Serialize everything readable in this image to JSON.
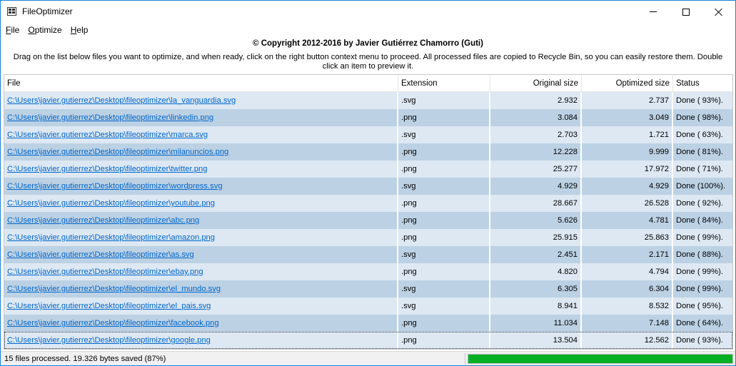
{
  "window": {
    "title": "FileOptimizer",
    "icon": "app-grid-icon"
  },
  "menu": [
    {
      "mnemonic": "F",
      "rest": "ile"
    },
    {
      "mnemonic": "O",
      "rest": "ptimize"
    },
    {
      "mnemonic": "H",
      "rest": "elp"
    }
  ],
  "header": {
    "copyright": "© Copyright 2012-2016 by Javier Gutiérrez Chamorro (Guti)",
    "instructions": "Drag on the list below files you want to optimize, and when ready, click on the right button context menu to proceed. All processed files are copied to Recycle Bin, so you can easily restore them. Double click an item to preview it."
  },
  "columns": {
    "file": "File",
    "extension": "Extension",
    "original_size": "Original size",
    "optimized_size": "Optimized size",
    "status": "Status"
  },
  "rows": [
    {
      "file": "C:\\Users\\javier.gutierrez\\Desktop\\fileoptimizer\\la_vanguardia.svg",
      "ext": ".svg",
      "orig": "2.932",
      "opt": "2.737",
      "status": "Done ( 93%)."
    },
    {
      "file": "C:\\Users\\javier.gutierrez\\Desktop\\fileoptimizer\\linkedin.png",
      "ext": ".png",
      "orig": "3.084",
      "opt": "3.049",
      "status": "Done ( 98%)."
    },
    {
      "file": "C:\\Users\\javier.gutierrez\\Desktop\\fileoptimizer\\marca.svg",
      "ext": ".svg",
      "orig": "2.703",
      "opt": "1.721",
      "status": "Done ( 63%)."
    },
    {
      "file": "C:\\Users\\javier.gutierrez\\Desktop\\fileoptimizer\\milanuncios.png",
      "ext": ".png",
      "orig": "12.228",
      "opt": "9.999",
      "status": "Done ( 81%)."
    },
    {
      "file": "C:\\Users\\javier.gutierrez\\Desktop\\fileoptimizer\\twitter.png",
      "ext": ".png",
      "orig": "25.277",
      "opt": "17.972",
      "status": "Done ( 71%)."
    },
    {
      "file": "C:\\Users\\javier.gutierrez\\Desktop\\fileoptimizer\\wordpress.svg",
      "ext": ".svg",
      "orig": "4.929",
      "opt": "4.929",
      "status": "Done (100%)."
    },
    {
      "file": "C:\\Users\\javier.gutierrez\\Desktop\\fileoptimizer\\youtube.png",
      "ext": ".png",
      "orig": "28.667",
      "opt": "26.528",
      "status": "Done ( 92%)."
    },
    {
      "file": "C:\\Users\\javier.gutierrez\\Desktop\\fileoptimizer\\abc.png",
      "ext": ".png",
      "orig": "5.626",
      "opt": "4.781",
      "status": "Done ( 84%)."
    },
    {
      "file": "C:\\Users\\javier.gutierrez\\Desktop\\fileoptimizer\\amazon.png",
      "ext": ".png",
      "orig": "25.915",
      "opt": "25.863",
      "status": "Done ( 99%)."
    },
    {
      "file": "C:\\Users\\javier.gutierrez\\Desktop\\fileoptimizer\\as.svg",
      "ext": ".svg",
      "orig": "2.451",
      "opt": "2.171",
      "status": "Done ( 88%)."
    },
    {
      "file": "C:\\Users\\javier.gutierrez\\Desktop\\fileoptimizer\\ebay.png",
      "ext": ".png",
      "orig": "4.820",
      "opt": "4.794",
      "status": "Done ( 99%)."
    },
    {
      "file": "C:\\Users\\javier.gutierrez\\Desktop\\fileoptimizer\\el_mundo.svg",
      "ext": ".svg",
      "orig": "6.305",
      "opt": "6.304",
      "status": "Done ( 99%)."
    },
    {
      "file": "C:\\Users\\javier.gutierrez\\Desktop\\fileoptimizer\\el_pais.svg",
      "ext": ".svg",
      "orig": "8.941",
      "opt": "8.532",
      "status": "Done ( 95%)."
    },
    {
      "file": "C:\\Users\\javier.gutierrez\\Desktop\\fileoptimizer\\facebook.png",
      "ext": ".png",
      "orig": "11.034",
      "opt": "7.148",
      "status": "Done ( 64%)."
    },
    {
      "file": "C:\\Users\\javier.gutierrez\\Desktop\\fileoptimizer\\google.png",
      "ext": ".png",
      "orig": "13.504",
      "opt": "12.562",
      "status": "Done ( 93%)."
    }
  ],
  "selected_row": 14,
  "statusbar": {
    "text": "15 files processed. 19.326 bytes saved (87%)",
    "progress_percent": 100,
    "progress_color": "#06b025"
  },
  "colors": {
    "row_light": "#dde8f3",
    "row_dark": "#bcd1e4",
    "link": "#0066cc",
    "window_border": "#1883d7"
  }
}
